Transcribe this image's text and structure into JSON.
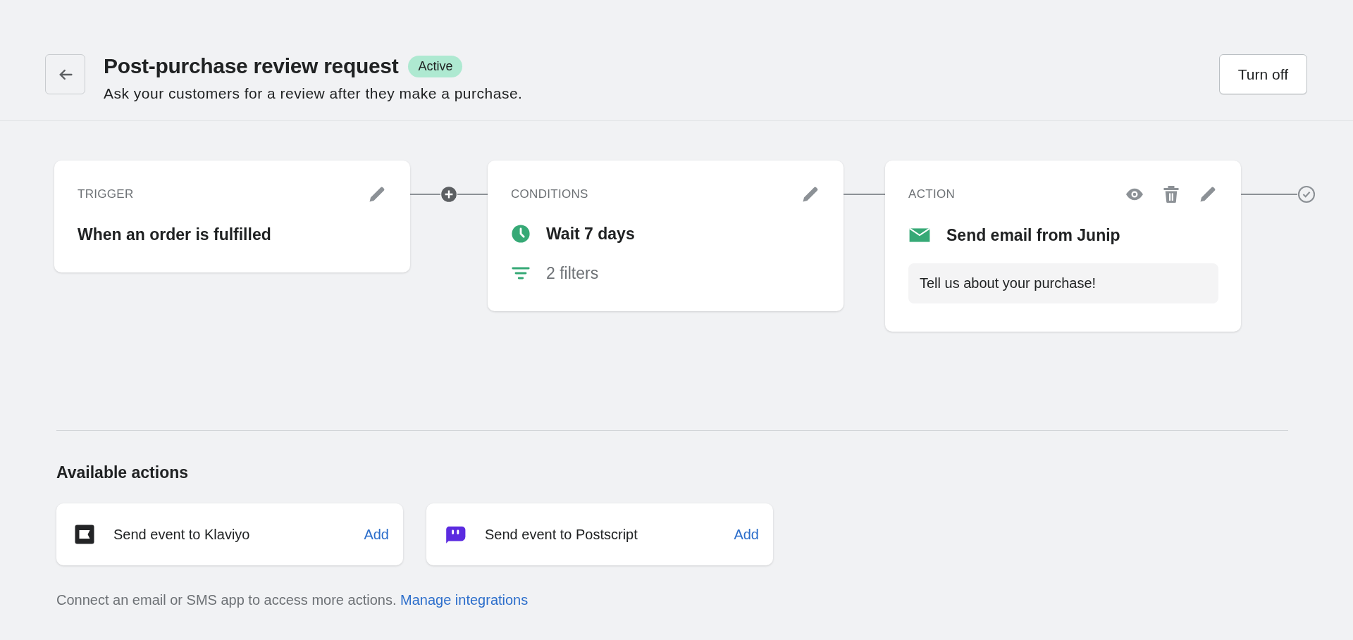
{
  "header": {
    "title": "Post-purchase review request",
    "status": {
      "label": "Active",
      "kind": "active"
    },
    "subtitle": "Ask your customers for a review after they make a purchase.",
    "button": "Turn off"
  },
  "steps": [
    {
      "kind": "trigger",
      "label": "TRIGGER",
      "title": "When an order is fulfilled"
    },
    {
      "kind": "conditions",
      "label": "CONDITIONS",
      "items": [
        {
          "kind": "wait",
          "text": "Wait 7 days"
        },
        {
          "kind": "filters",
          "text": "2 filters"
        }
      ]
    },
    {
      "kind": "action",
      "label": "ACTION",
      "title": "Send email from Junip",
      "message": "Tell us about your purchase!"
    }
  ],
  "available_actions": {
    "title": "Available actions",
    "items": [
      {
        "kind": "klaviyo",
        "label": "Send event to Klaviyo",
        "button": "Add"
      },
      {
        "kind": "postscript",
        "label": "Send event to Postscript",
        "button": "Add"
      }
    ],
    "footer": {
      "text": "Connect an email or SMS app to access more actions.",
      "link": "Manage integrations"
    }
  }
}
